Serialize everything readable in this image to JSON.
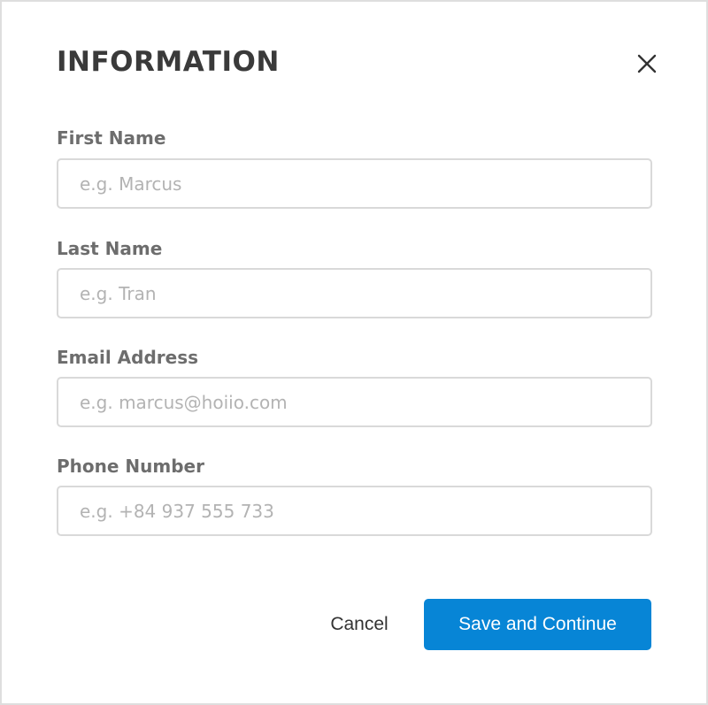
{
  "dialog": {
    "title": "INFORMATION",
    "close_icon": "close-icon"
  },
  "fields": [
    {
      "label": "First Name",
      "value": "",
      "placeholder": "e.g. Marcus"
    },
    {
      "label": "Last Name",
      "value": "",
      "placeholder": "e.g. Tran"
    },
    {
      "label": "Email Address",
      "value": "",
      "placeholder": "e.g. marcus@hoiio.com"
    },
    {
      "label": "Phone Number",
      "value": "",
      "placeholder": "e.g. +84 937 555 733"
    }
  ],
  "actions": {
    "cancel_label": "Cancel",
    "primary_label": "Save and Continue"
  },
  "colors": {
    "primary": "#0785d6",
    "title_text": "#3a3a3a",
    "label_text": "#6d6d6d",
    "border": "#d9d9d9",
    "placeholder": "#b3b3b3"
  }
}
